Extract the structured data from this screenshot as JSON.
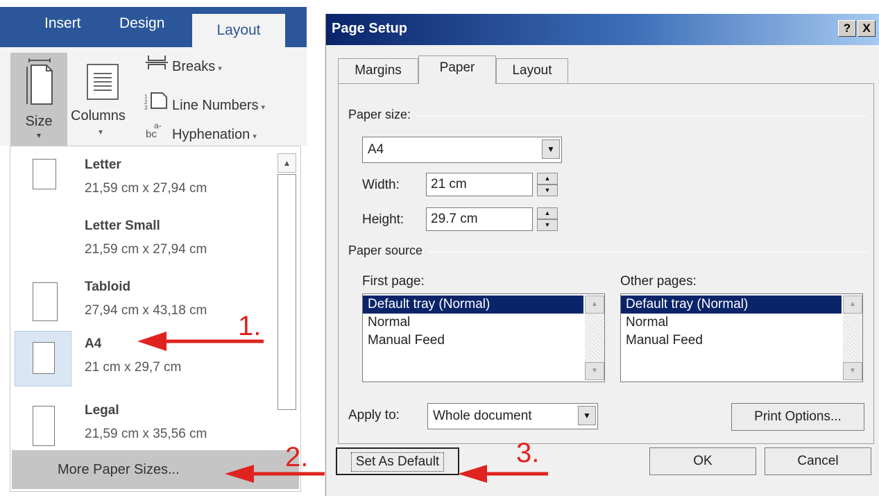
{
  "ribbon": {
    "tabs": {
      "insert": "Insert",
      "design": "Design",
      "layout": "Layout"
    },
    "size_label": "Size",
    "columns_label": "Columns",
    "breaks_label": "Breaks",
    "line_numbers_label": "Line Numbers",
    "hyphenation_label": "Hyphenation",
    "caret": "▾"
  },
  "size_menu": {
    "items": [
      {
        "name": "Letter",
        "dims": "21,59 cm x 27,94 cm"
      },
      {
        "name": "Letter Small",
        "dims": "21,59 cm x 27,94 cm"
      },
      {
        "name": "Tabloid",
        "dims": "27,94 cm x 43,18 cm"
      },
      {
        "name": "A4",
        "dims": "21 cm x 29,7 cm"
      },
      {
        "name": "Legal",
        "dims": "21,59 cm x 35,56 cm"
      }
    ],
    "selected": "A4",
    "more_label": "More Paper Sizes..."
  },
  "dialog": {
    "title": "Page Setup",
    "help_glyph": "?",
    "close_glyph": "X",
    "tabs": {
      "margins": "Margins",
      "paper": "Paper",
      "layout": "Layout"
    },
    "active_tab": "Paper",
    "paper_size_group": "Paper size:",
    "paper_size_value": "A4",
    "width_label": "Width:",
    "width_value": "21 cm",
    "height_label": "Height:",
    "height_value": "29.7 cm",
    "paper_source_group": "Paper source",
    "first_page_label": "First page:",
    "other_pages_label": "Other pages:",
    "first_page_options": [
      "Default tray (Normal)",
      "Normal",
      "Manual Feed"
    ],
    "other_pages_options": [
      "Default tray (Normal)",
      "Normal",
      "Manual Feed"
    ],
    "apply_to_label": "Apply to:",
    "apply_to_value": "Whole document",
    "print_options_label": "Print Options...",
    "set_default_label": "Set As Default",
    "ok_label": "OK",
    "cancel_label": "Cancel"
  },
  "annotations": {
    "step1": "1.",
    "step2": "2.",
    "step3": "3."
  },
  "colors": {
    "ribbon_blue": "#2b579a",
    "title_navy": "#0a246a",
    "selection": "#0a246a",
    "arrow_red": "#e0231e"
  }
}
